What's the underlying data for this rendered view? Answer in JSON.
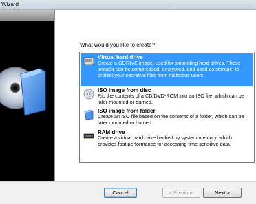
{
  "window": {
    "title": "Wizard"
  },
  "prompt": "What would you like to create?",
  "options": [
    {
      "icon": "hard-drive-icon",
      "title": "Virtual hard drive",
      "description": "Create a GDRIVE image, used for simulating hard drives. These images can be compressed, encrypted, and used as storage, to protect your secretive files from malicious users.",
      "selected": true
    },
    {
      "icon": "disc-icon",
      "title": "ISO image from disc",
      "description": "Rip the contents of a CD/DVD-ROM into an ISO file, which can be later mounted or burned.",
      "selected": false
    },
    {
      "icon": "folder-icon",
      "title": "ISO image from folder",
      "description": "Create an ISO file based on the contents of a folder, which can be later mounted or burned.",
      "selected": false
    },
    {
      "icon": "ram-chip-icon",
      "title": "RAM drive",
      "description": "Create a virtual hard drive backed by system memory, which provides fast performance for accessing time sensitive data.",
      "selected": false
    }
  ],
  "buttons": {
    "cancel": "Cancel",
    "previous": "< Previous",
    "next": "Next >"
  },
  "colors": {
    "selection": "#3399ff",
    "banner": "#000000"
  }
}
